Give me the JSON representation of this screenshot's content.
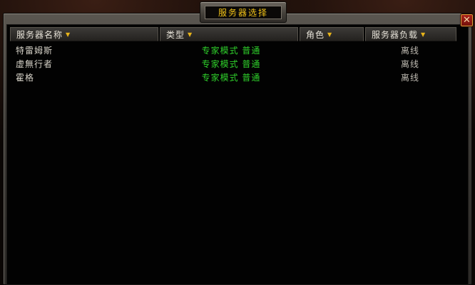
{
  "window": {
    "title": "服务器选择",
    "close_label": "✕"
  },
  "columns": [
    {
      "label": "服务器名称",
      "sort": "▼"
    },
    {
      "label": "类型",
      "sort": "▼"
    },
    {
      "label": "角色",
      "sort": "▼"
    },
    {
      "label": "服务器负载",
      "sort": "▼"
    }
  ],
  "servers": [
    {
      "name": "特雷姆斯",
      "type": "专家模式 普通",
      "role": "",
      "load": "离线"
    },
    {
      "name": "虚無行者",
      "type": "专家模式 普通",
      "role": "",
      "load": "离线"
    },
    {
      "name": "霍格",
      "type": "专家模式 普通",
      "role": "",
      "load": "离线"
    }
  ],
  "colors": {
    "title_text": "#f2c318",
    "type_text": "#2fd12b",
    "sort_arrow": "#e8b41a"
  }
}
